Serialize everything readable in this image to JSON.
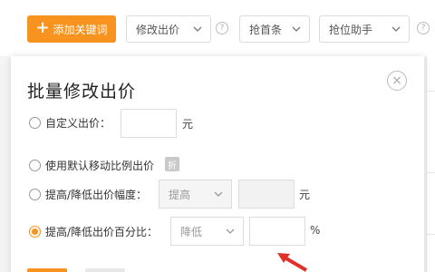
{
  "toolbar": {
    "add_keyword_label": "添加关键词",
    "modify_bid_label": "修改出价",
    "first_place_label": "抢首条",
    "rank_helper_label": "抢位助手",
    "help_mark": "?"
  },
  "modal": {
    "title": "批量修改出价",
    "close_symbol": "×",
    "options": [
      {
        "label": "自定义出价：",
        "selected": false,
        "unit": "元"
      },
      {
        "label": "使用默认移动比例出价",
        "selected": false,
        "badge": "折"
      },
      {
        "label": "提高/降低出价幅度：",
        "selected": false,
        "select_value": "提高",
        "unit": "元"
      },
      {
        "label": "提高/降低出价百分比：",
        "selected": true,
        "select_value": "降低",
        "unit": "%"
      }
    ]
  },
  "colors": {
    "accent": "#f7931e",
    "arrow": "#e0302a"
  }
}
